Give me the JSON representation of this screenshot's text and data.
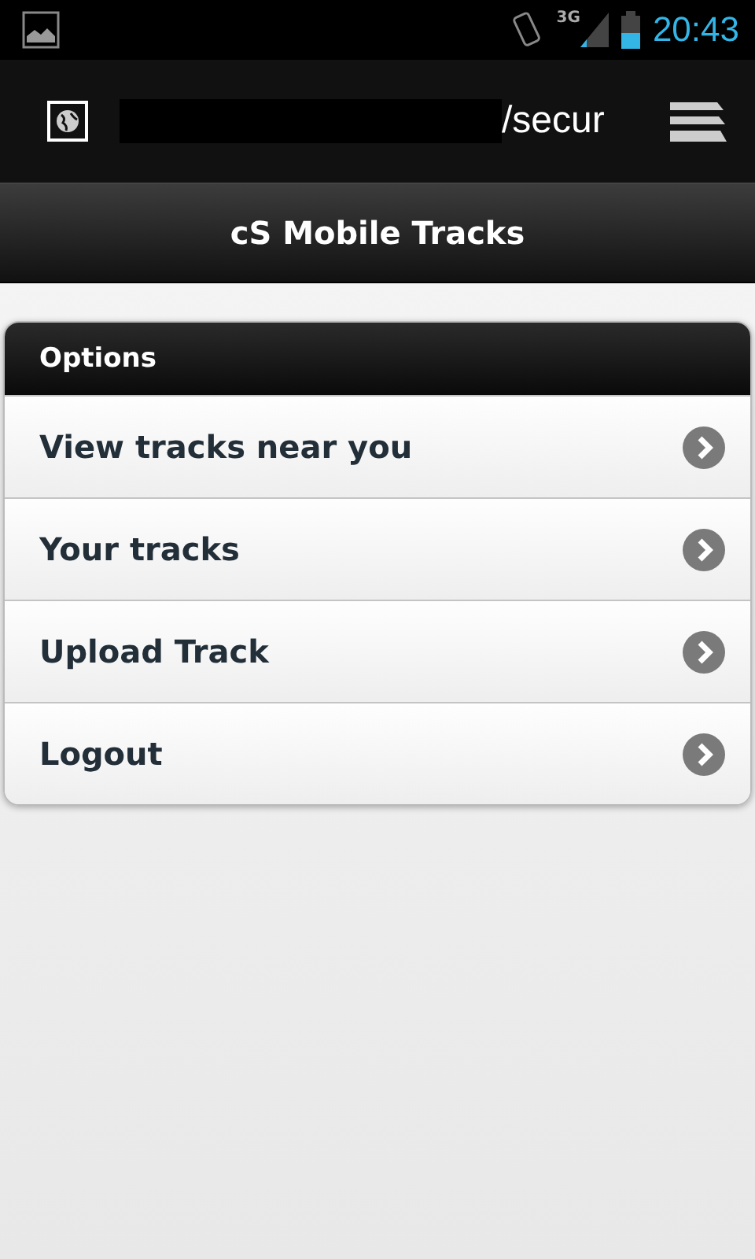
{
  "status_bar": {
    "network": "3G",
    "time": "20:43"
  },
  "browser_bar": {
    "url": "/secur"
  },
  "header": {
    "title": "cS Mobile Tracks"
  },
  "list": {
    "title": "Options",
    "items": [
      {
        "label": "View tracks near you"
      },
      {
        "label": "Your tracks"
      },
      {
        "label": "Upload Track"
      },
      {
        "label": "Logout"
      }
    ]
  }
}
